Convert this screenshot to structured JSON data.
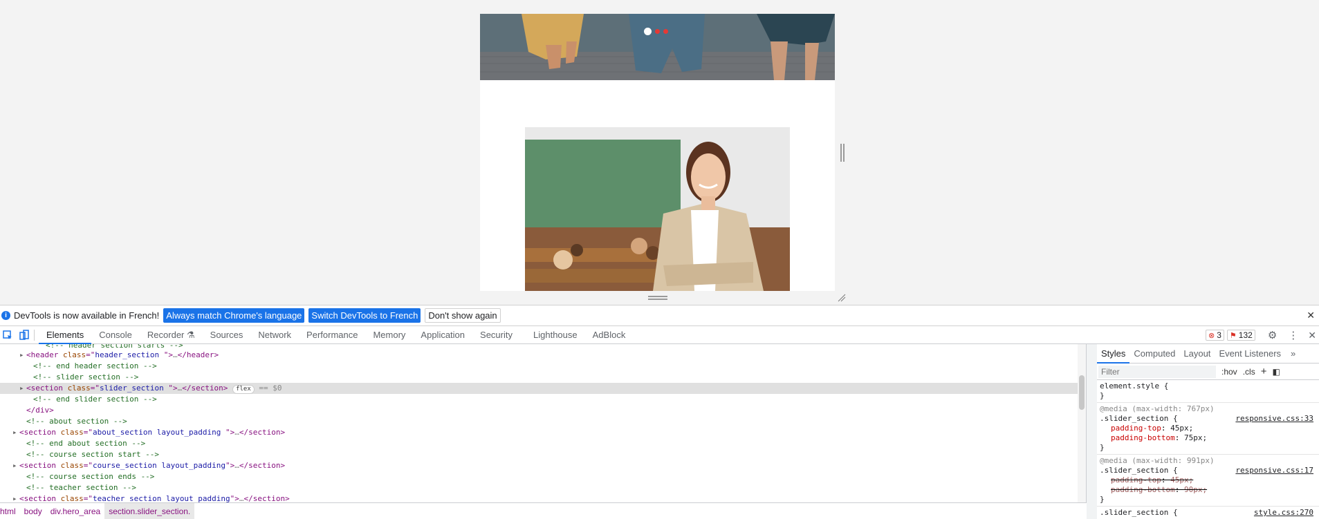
{
  "infobar": {
    "message": "DevTools is now available in French!",
    "btn_match": "Always match Chrome's language",
    "btn_switch": "Switch DevTools to French",
    "btn_dismiss": "Don't show again"
  },
  "tabs": [
    "Elements",
    "Console",
    "Recorder",
    "Sources",
    "Network",
    "Performance",
    "Memory",
    "Application",
    "Security",
    "Lighthouse",
    "AdBlock"
  ],
  "toolbar": {
    "errors": "3",
    "warnings": "132"
  },
  "dom_lines": [
    {
      "indent": 3,
      "tri": "▸",
      "parts": [
        [
          "tag",
          "<header "
        ],
        [
          "attr",
          "class"
        ],
        [
          "tag",
          "=\""
        ],
        [
          "val",
          "header_section "
        ],
        [
          "tag",
          "\">"
        ],
        [
          "eq",
          "…"
        ],
        [
          "tag",
          "</header>"
        ]
      ]
    },
    {
      "indent": 4,
      "tri": "",
      "parts": [
        [
          "comment",
          "<!-- end header section -->"
        ]
      ]
    },
    {
      "indent": 4,
      "tri": "",
      "parts": [
        [
          "comment",
          "<!-- slider section -->"
        ]
      ]
    },
    {
      "indent": 3,
      "tri": "▸",
      "selected": true,
      "parts": [
        [
          "tag",
          "<section "
        ],
        [
          "attr",
          "class"
        ],
        [
          "tag",
          "=\""
        ],
        [
          "val",
          "slider_section "
        ],
        [
          "tag",
          "\">"
        ],
        [
          "eq",
          "…"
        ],
        [
          "tag",
          "</section>"
        ]
      ],
      "pill": "flex",
      "marker": " == $0"
    },
    {
      "indent": 4,
      "tri": "",
      "parts": [
        [
          "comment",
          "<!-- end slider section -->"
        ]
      ]
    },
    {
      "indent": 3,
      "tri": "",
      "parts": [
        [
          "tag",
          "</div>"
        ]
      ]
    },
    {
      "indent": 3,
      "tri": "",
      "parts": [
        [
          "comment",
          "<!-- about section -->"
        ]
      ]
    },
    {
      "indent": 2,
      "tri": "▸",
      "parts": [
        [
          "tag",
          "<section "
        ],
        [
          "attr",
          "class"
        ],
        [
          "tag",
          "=\""
        ],
        [
          "val",
          "about_section layout_padding "
        ],
        [
          "tag",
          "\">"
        ],
        [
          "eq",
          "…"
        ],
        [
          "tag",
          "</section>"
        ]
      ]
    },
    {
      "indent": 3,
      "tri": "",
      "parts": [
        [
          "comment",
          "<!-- end about section -->"
        ]
      ]
    },
    {
      "indent": 3,
      "tri": "",
      "parts": [
        [
          "comment",
          "<!-- course section start -->"
        ]
      ]
    },
    {
      "indent": 2,
      "tri": "▸",
      "parts": [
        [
          "tag",
          "<section "
        ],
        [
          "attr",
          "class"
        ],
        [
          "tag",
          "=\""
        ],
        [
          "val",
          "course_section layout_padding"
        ],
        [
          "tag",
          "\">"
        ],
        [
          "eq",
          "…"
        ],
        [
          "tag",
          "</section>"
        ]
      ]
    },
    {
      "indent": 3,
      "tri": "",
      "parts": [
        [
          "comment",
          "<!-- course section ends -->"
        ]
      ]
    },
    {
      "indent": 3,
      "tri": "",
      "parts": [
        [
          "comment",
          "<!-- teacher section -->"
        ]
      ]
    },
    {
      "indent": 2,
      "tri": "▸",
      "parts": [
        [
          "tag",
          "<section "
        ],
        [
          "attr",
          "class"
        ],
        [
          "tag",
          "=\""
        ],
        [
          "val",
          "teacher_section layout_padding"
        ],
        [
          "tag",
          "\">"
        ],
        [
          "eq",
          "…"
        ],
        [
          "tag",
          "</section>"
        ]
      ]
    }
  ],
  "breadcrumb": [
    "html",
    "body",
    "div.hero_area",
    "section.slider_section."
  ],
  "styles": {
    "tabs": [
      "Styles",
      "Computed",
      "Layout",
      "Event Listeners"
    ],
    "filter_placeholder": "Filter",
    "hov": ":hov",
    "cls": ".cls",
    "element_style": "element.style {",
    "close_brace": "}",
    "rule1": {
      "media": "@media (max-width: 767px)",
      "selector": ".slider_section {",
      "source": "responsive.css:33",
      "props": [
        [
          "padding-top",
          "45px;"
        ],
        [
          "padding-bottom",
          "75px;"
        ]
      ]
    },
    "rule2": {
      "media": "@media (max-width: 991px)",
      "selector": ".slider_section {",
      "source": "responsive.css:17",
      "props": [
        [
          "padding-top",
          "45px;"
        ],
        [
          "padding-bottom",
          "90px;"
        ]
      ]
    },
    "rule3": {
      "selector": ".slider_section {",
      "source": "style.css:270"
    }
  }
}
